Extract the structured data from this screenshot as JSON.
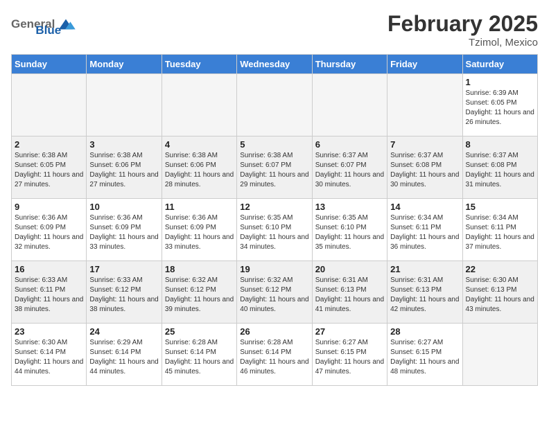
{
  "header": {
    "logo_general": "General",
    "logo_blue": "Blue",
    "month_title": "February 2025",
    "location": "Tzimol, Mexico"
  },
  "days_of_week": [
    "Sunday",
    "Monday",
    "Tuesday",
    "Wednesday",
    "Thursday",
    "Friday",
    "Saturday"
  ],
  "weeks": [
    {
      "shaded": false,
      "days": [
        {
          "num": "",
          "info": ""
        },
        {
          "num": "",
          "info": ""
        },
        {
          "num": "",
          "info": ""
        },
        {
          "num": "",
          "info": ""
        },
        {
          "num": "",
          "info": ""
        },
        {
          "num": "",
          "info": ""
        },
        {
          "num": "1",
          "info": "Sunrise: 6:39 AM\nSunset: 6:05 PM\nDaylight: 11 hours and 26 minutes."
        }
      ]
    },
    {
      "shaded": true,
      "days": [
        {
          "num": "2",
          "info": "Sunrise: 6:38 AM\nSunset: 6:05 PM\nDaylight: 11 hours and 27 minutes."
        },
        {
          "num": "3",
          "info": "Sunrise: 6:38 AM\nSunset: 6:06 PM\nDaylight: 11 hours and 27 minutes."
        },
        {
          "num": "4",
          "info": "Sunrise: 6:38 AM\nSunset: 6:06 PM\nDaylight: 11 hours and 28 minutes."
        },
        {
          "num": "5",
          "info": "Sunrise: 6:38 AM\nSunset: 6:07 PM\nDaylight: 11 hours and 29 minutes."
        },
        {
          "num": "6",
          "info": "Sunrise: 6:37 AM\nSunset: 6:07 PM\nDaylight: 11 hours and 30 minutes."
        },
        {
          "num": "7",
          "info": "Sunrise: 6:37 AM\nSunset: 6:08 PM\nDaylight: 11 hours and 30 minutes."
        },
        {
          "num": "8",
          "info": "Sunrise: 6:37 AM\nSunset: 6:08 PM\nDaylight: 11 hours and 31 minutes."
        }
      ]
    },
    {
      "shaded": false,
      "days": [
        {
          "num": "9",
          "info": "Sunrise: 6:36 AM\nSunset: 6:09 PM\nDaylight: 11 hours and 32 minutes."
        },
        {
          "num": "10",
          "info": "Sunrise: 6:36 AM\nSunset: 6:09 PM\nDaylight: 11 hours and 33 minutes."
        },
        {
          "num": "11",
          "info": "Sunrise: 6:36 AM\nSunset: 6:09 PM\nDaylight: 11 hours and 33 minutes."
        },
        {
          "num": "12",
          "info": "Sunrise: 6:35 AM\nSunset: 6:10 PM\nDaylight: 11 hours and 34 minutes."
        },
        {
          "num": "13",
          "info": "Sunrise: 6:35 AM\nSunset: 6:10 PM\nDaylight: 11 hours and 35 minutes."
        },
        {
          "num": "14",
          "info": "Sunrise: 6:34 AM\nSunset: 6:11 PM\nDaylight: 11 hours and 36 minutes."
        },
        {
          "num": "15",
          "info": "Sunrise: 6:34 AM\nSunset: 6:11 PM\nDaylight: 11 hours and 37 minutes."
        }
      ]
    },
    {
      "shaded": true,
      "days": [
        {
          "num": "16",
          "info": "Sunrise: 6:33 AM\nSunset: 6:11 PM\nDaylight: 11 hours and 38 minutes."
        },
        {
          "num": "17",
          "info": "Sunrise: 6:33 AM\nSunset: 6:12 PM\nDaylight: 11 hours and 38 minutes."
        },
        {
          "num": "18",
          "info": "Sunrise: 6:32 AM\nSunset: 6:12 PM\nDaylight: 11 hours and 39 minutes."
        },
        {
          "num": "19",
          "info": "Sunrise: 6:32 AM\nSunset: 6:12 PM\nDaylight: 11 hours and 40 minutes."
        },
        {
          "num": "20",
          "info": "Sunrise: 6:31 AM\nSunset: 6:13 PM\nDaylight: 11 hours and 41 minutes."
        },
        {
          "num": "21",
          "info": "Sunrise: 6:31 AM\nSunset: 6:13 PM\nDaylight: 11 hours and 42 minutes."
        },
        {
          "num": "22",
          "info": "Sunrise: 6:30 AM\nSunset: 6:13 PM\nDaylight: 11 hours and 43 minutes."
        }
      ]
    },
    {
      "shaded": false,
      "days": [
        {
          "num": "23",
          "info": "Sunrise: 6:30 AM\nSunset: 6:14 PM\nDaylight: 11 hours and 44 minutes."
        },
        {
          "num": "24",
          "info": "Sunrise: 6:29 AM\nSunset: 6:14 PM\nDaylight: 11 hours and 44 minutes."
        },
        {
          "num": "25",
          "info": "Sunrise: 6:28 AM\nSunset: 6:14 PM\nDaylight: 11 hours and 45 minutes."
        },
        {
          "num": "26",
          "info": "Sunrise: 6:28 AM\nSunset: 6:14 PM\nDaylight: 11 hours and 46 minutes."
        },
        {
          "num": "27",
          "info": "Sunrise: 6:27 AM\nSunset: 6:15 PM\nDaylight: 11 hours and 47 minutes."
        },
        {
          "num": "28",
          "info": "Sunrise: 6:27 AM\nSunset: 6:15 PM\nDaylight: 11 hours and 48 minutes."
        },
        {
          "num": "",
          "info": ""
        }
      ]
    }
  ]
}
